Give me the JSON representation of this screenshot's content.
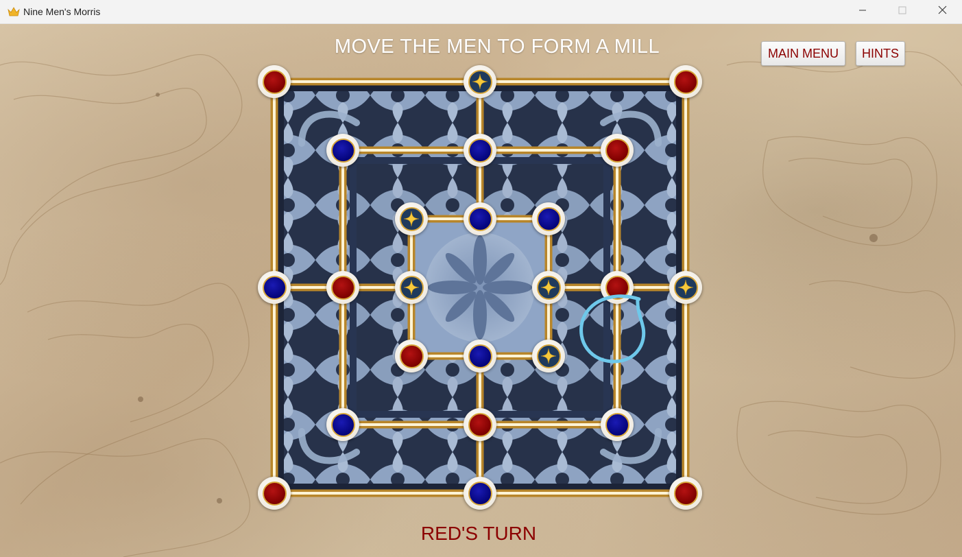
{
  "window": {
    "title": "Nine Men's Morris",
    "app_icon": "crown-icon",
    "controls": [
      "minimize-icon",
      "maximize-icon",
      "close-icon"
    ]
  },
  "game": {
    "instruction": "MOVE THE MEN TO FORM A MILL",
    "main_menu_label": "MAIN MENU",
    "hints_label": "HINTS",
    "turn_text": "RED'S TURN",
    "colors": {
      "red_piece": "#8b0000",
      "blue_piece": "#06068a",
      "button_text": "#8b0000",
      "instruction_text": "#ffffff",
      "highlight_circle": "#6ec8ea",
      "board_frame": "#e8b84a",
      "board_ornament": "#9bb0cc"
    }
  },
  "board": {
    "points": [
      {
        "id": "a7",
        "piece": "red"
      },
      {
        "id": "d7",
        "piece": "empty"
      },
      {
        "id": "g7",
        "piece": "red"
      },
      {
        "id": "b6",
        "piece": "blue"
      },
      {
        "id": "d6",
        "piece": "blue"
      },
      {
        "id": "f6",
        "piece": "red"
      },
      {
        "id": "c5",
        "piece": "empty"
      },
      {
        "id": "d5",
        "piece": "blue"
      },
      {
        "id": "e5",
        "piece": "blue"
      },
      {
        "id": "a4",
        "piece": "blue"
      },
      {
        "id": "b4",
        "piece": "red"
      },
      {
        "id": "c4",
        "piece": "empty"
      },
      {
        "id": "e4",
        "piece": "empty"
      },
      {
        "id": "f4",
        "piece": "red"
      },
      {
        "id": "g4",
        "piece": "empty"
      },
      {
        "id": "c3",
        "piece": "red"
      },
      {
        "id": "d3",
        "piece": "blue"
      },
      {
        "id": "e3",
        "piece": "empty"
      },
      {
        "id": "b2",
        "piece": "blue"
      },
      {
        "id": "d2",
        "piece": "red"
      },
      {
        "id": "f2",
        "piece": "blue"
      },
      {
        "id": "a1",
        "piece": "red"
      },
      {
        "id": "d1",
        "piece": "blue"
      },
      {
        "id": "g1",
        "piece": "red"
      }
    ],
    "highlighted_point": "f4"
  }
}
